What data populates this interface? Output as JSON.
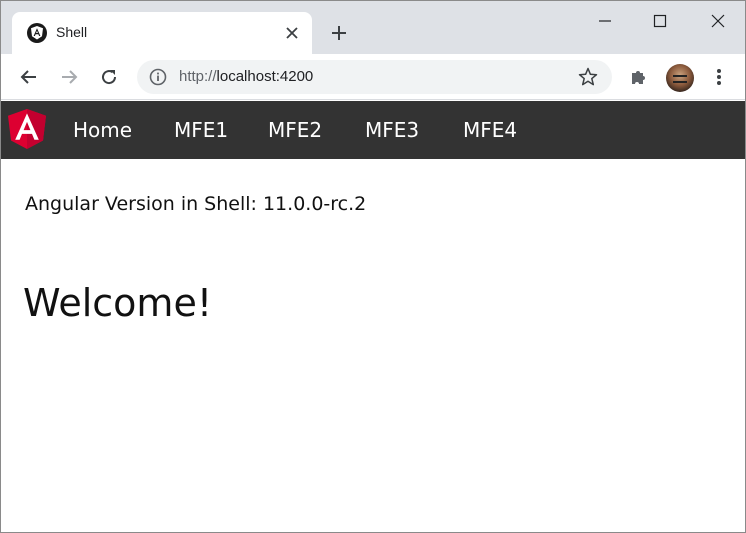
{
  "browser": {
    "tab": {
      "title": "Shell",
      "favicon": "angular-icon"
    },
    "new_tab_icon": "plus-icon",
    "window_controls": [
      "minimize-icon",
      "maximize-icon",
      "close-icon"
    ],
    "url_scheme": "http://",
    "url_host": "localhost:4200"
  },
  "navbar": {
    "logo": "angular-logo",
    "items": [
      {
        "label": "Home"
      },
      {
        "label": "MFE1"
      },
      {
        "label": "MFE2"
      },
      {
        "label": "MFE3"
      },
      {
        "label": "MFE4"
      }
    ]
  },
  "content": {
    "version_text": "Angular Version in Shell: 11.0.0-rc.2",
    "heading": "Welcome!"
  },
  "colors": {
    "navbar_bg": "#333333",
    "angular_red": "#dd0031",
    "tabstrip_bg": "#dee1e6"
  }
}
